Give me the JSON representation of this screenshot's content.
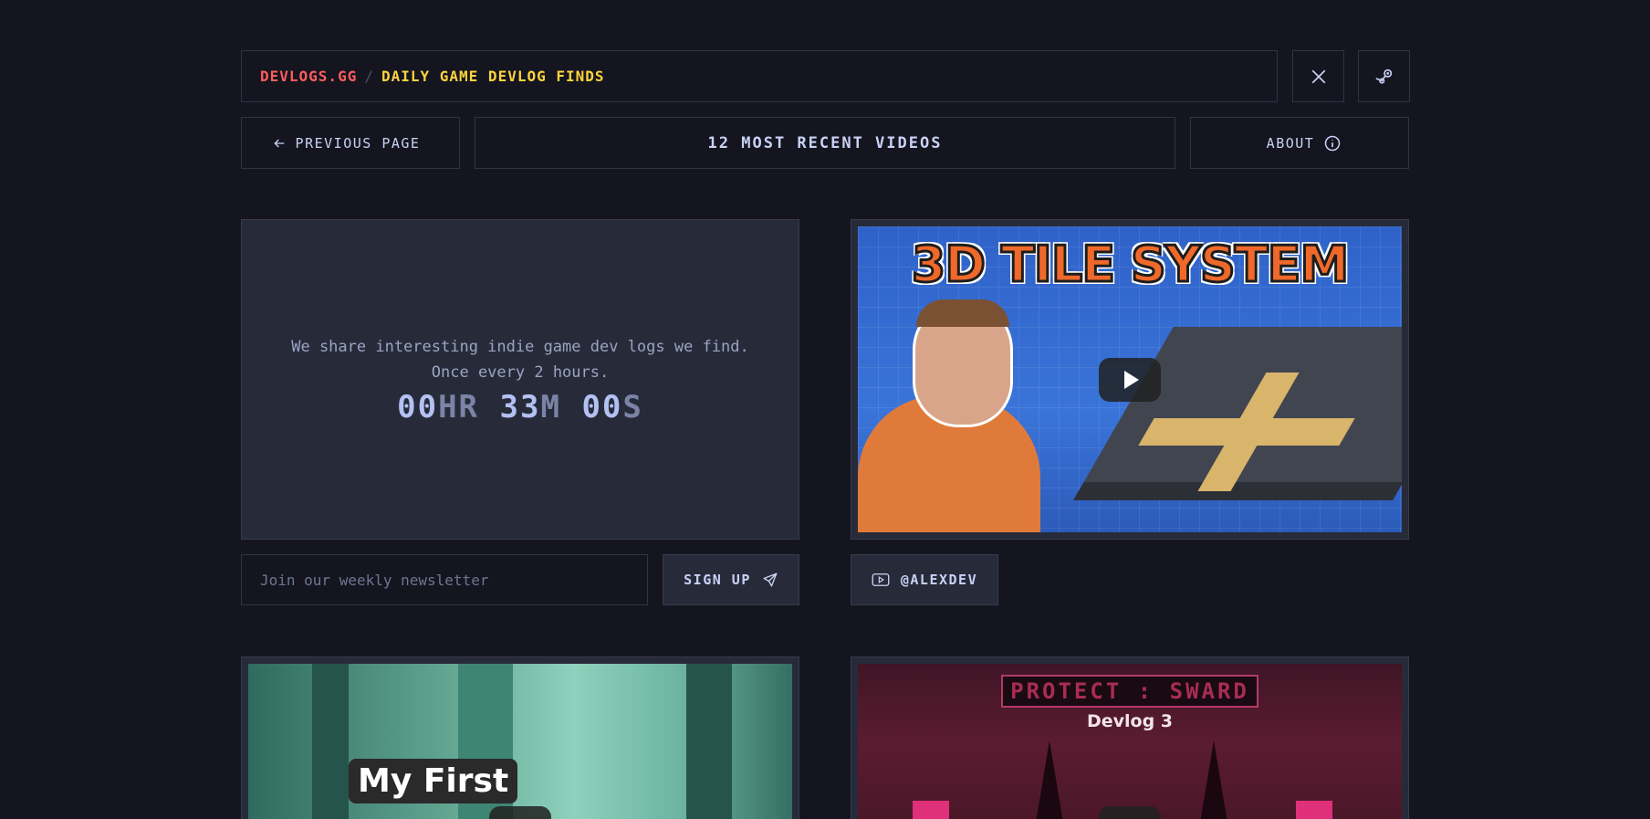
{
  "header": {
    "site_name": "DEVLOGS.GG",
    "separator": "/",
    "tagline": "DAILY GAME DEVLOG FINDS"
  },
  "nav": {
    "previous_label": "PREVIOUS PAGE",
    "center_title": "12 MOST RECENT VIDEOS",
    "about_label": "ABOUT"
  },
  "info": {
    "description": "We share interesting indie game dev logs we find. Once every 2 hours.",
    "countdown": {
      "hours": "00",
      "hours_unit": "HR",
      "minutes": "33",
      "minutes_unit": "M",
      "seconds": "00",
      "seconds_unit": "S"
    }
  },
  "newsletter": {
    "placeholder": "Join our weekly newsletter",
    "signup_label": "SIGN UP"
  },
  "videos": [
    {
      "thumb_title": "3D TILE SYSTEM",
      "channel": "@ALEXDEV"
    },
    {
      "thumb_title": "My First"
    },
    {
      "thumb_title": "PROTECT : SWARD",
      "thumb_subtitle": "Devlog 3"
    }
  ],
  "icons": {
    "x": "x-logo-icon",
    "steam": "steam-icon",
    "back": "arrow-left-icon",
    "about": "info-icon",
    "send": "send-icon",
    "youtube": "youtube-icon",
    "play": "play-icon"
  },
  "colors": {
    "background": "#14151f",
    "site_name": "#ff5d5d",
    "tagline": "#ffd33d",
    "card": "#272b39",
    "accent_text": "#b3c1f2"
  }
}
